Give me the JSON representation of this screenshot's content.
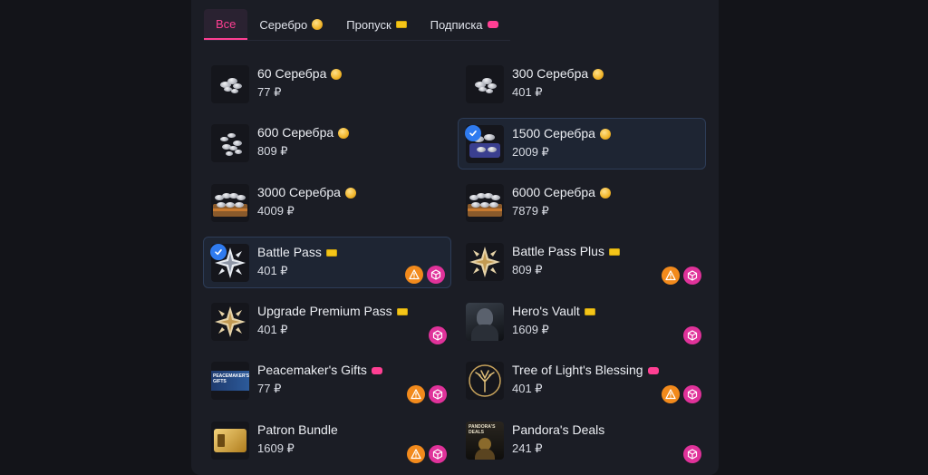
{
  "tabs": [
    {
      "label": "Все",
      "icon": "none"
    },
    {
      "label": "Серебро",
      "icon": "coin-icon"
    },
    {
      "label": "Пропуск",
      "icon": "ticket-icon"
    },
    {
      "label": "Подписка",
      "icon": "subscription-icon"
    }
  ],
  "items": [
    {
      "name": "60 Серебра",
      "price": "77 ₽",
      "tag": "coin",
      "selected": false,
      "warn": false,
      "gift": false,
      "thumb": "silver-small"
    },
    {
      "name": "300 Серебра",
      "price": "401 ₽",
      "tag": "coin",
      "selected": false,
      "warn": false,
      "gift": false,
      "thumb": "silver-small"
    },
    {
      "name": "600 Серебра",
      "price": "809 ₽",
      "tag": "coin",
      "selected": false,
      "warn": false,
      "gift": false,
      "thumb": "silver-medium"
    },
    {
      "name": "1500 Серебра",
      "price": "2009 ₽",
      "tag": "coin",
      "selected": true,
      "warn": false,
      "gift": false,
      "thumb": "silver-chest"
    },
    {
      "name": "3000 Серебра",
      "price": "4009 ₽",
      "tag": "coin",
      "selected": false,
      "warn": false,
      "gift": false,
      "thumb": "silver-crate"
    },
    {
      "name": "6000 Серебра",
      "price": "7879 ₽",
      "tag": "coin",
      "selected": false,
      "warn": false,
      "gift": false,
      "thumb": "silver-crate"
    },
    {
      "name": "Battle Pass",
      "price": "401 ₽",
      "tag": "ticket",
      "selected": true,
      "warn": true,
      "gift": true,
      "thumb": "emblem-silver"
    },
    {
      "name": "Battle Pass Plus",
      "price": "809 ₽",
      "tag": "ticket",
      "selected": false,
      "warn": true,
      "gift": true,
      "thumb": "emblem-gold"
    },
    {
      "name": "Upgrade Premium Pass",
      "price": "401 ₽",
      "tag": "ticket",
      "selected": false,
      "warn": false,
      "gift": true,
      "thumb": "emblem-gold"
    },
    {
      "name": "Hero's Vault",
      "price": "1609 ₽",
      "tag": "ticket",
      "selected": false,
      "warn": false,
      "gift": true,
      "thumb": "hero-dark"
    },
    {
      "name": "Peacemaker's Gifts",
      "price": "77 ₽",
      "tag": "subscription",
      "selected": false,
      "warn": true,
      "gift": true,
      "thumb": "peacemaker-banner"
    },
    {
      "name": "Tree of Light's Blessing",
      "price": "401 ₽",
      "tag": "subscription",
      "selected": false,
      "warn": true,
      "gift": true,
      "thumb": "tree-emblem"
    },
    {
      "name": "Patron Bundle",
      "price": "1609 ₽",
      "tag": "none",
      "selected": false,
      "warn": true,
      "gift": true,
      "thumb": "gold-card"
    },
    {
      "name": "Pandora's Deals",
      "price": "241 ₽",
      "tag": "none",
      "selected": false,
      "warn": false,
      "gift": true,
      "thumb": "pandora-deals"
    }
  ],
  "thumb_text": {
    "peacemaker": "PEACEMAKER'S GIFTS",
    "pandora": "PANDORA'S DEALS"
  },
  "colors": {
    "accent_pink": "#ff3f93",
    "selected_check": "#2f7bf0",
    "warn_badge": "#f28a1c",
    "gift_badge": "#e0329a",
    "panel_bg": "#1b1d25",
    "page_bg": "#131419"
  }
}
